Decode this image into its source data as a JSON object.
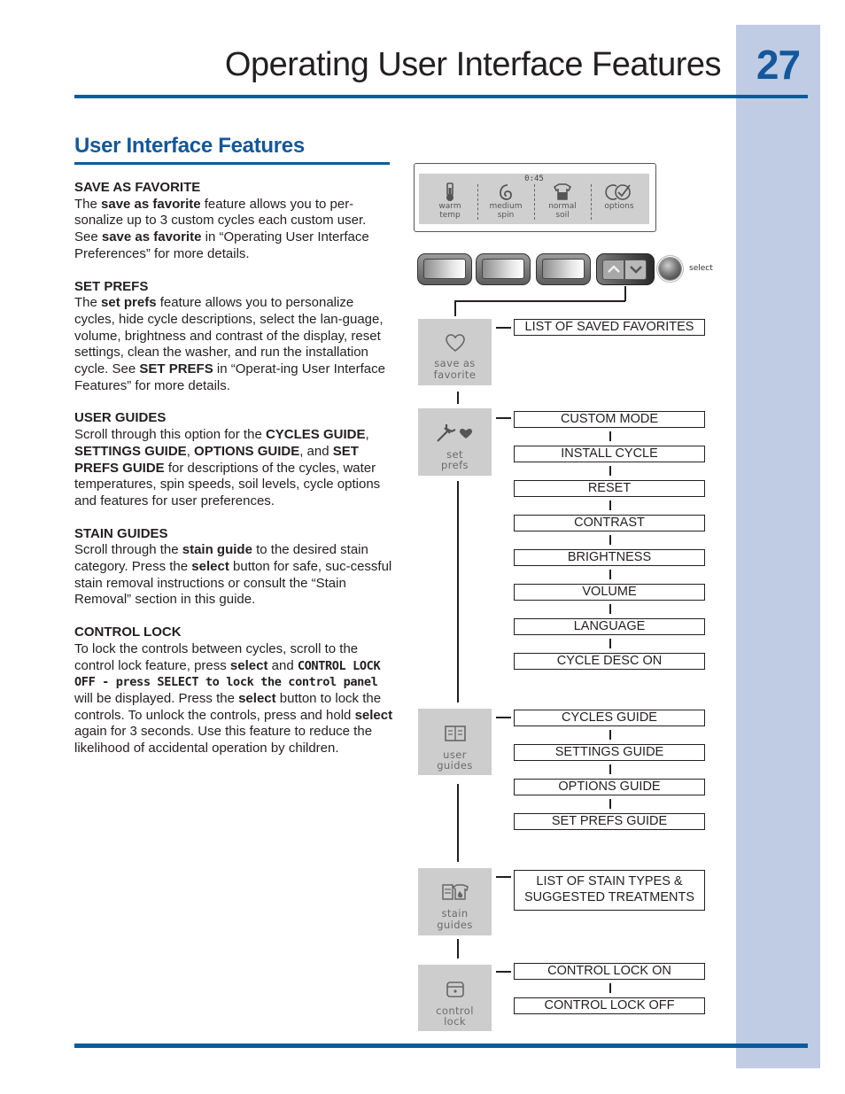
{
  "page": {
    "title": "Operating User Interface Features",
    "page_number": "27",
    "accent_color": "#075c9e",
    "sidebar_color": "#bfcce3"
  },
  "section": {
    "title": "User Interface Features"
  },
  "text_blocks": [
    {
      "heading": "SAVE AS FAVORITE",
      "segments": [
        {
          "t": "The "
        },
        {
          "t": "save as favorite",
          "b": true
        },
        {
          "t": " feature allows you to per-sonalize up to 3 custom cycles each custom user. See "
        },
        {
          "t": "save as favorite",
          "b": true
        },
        {
          "t": " in “Operating User Interface Preferences” for more details."
        }
      ]
    },
    {
      "heading": "SET PREFS",
      "segments": [
        {
          "t": "The "
        },
        {
          "t": "set prefs",
          "b": true
        },
        {
          "t": " feature allows you to personalize cycles, hide cycle descriptions, select the lan-guage, volume, brightness and contrast of the display, reset settings, clean the washer, and run the installation cycle. See "
        },
        {
          "t": "SET PREFS",
          "b": true
        },
        {
          "t": " in “Operat-ing User Interface Features” for more details."
        }
      ]
    },
    {
      "heading": "USER GUIDES",
      "segments": [
        {
          "t": "Scroll through this option for the "
        },
        {
          "t": "CYCLES GUIDE",
          "b": true
        },
        {
          "t": ", "
        },
        {
          "t": "SETTINGS GUIDE",
          "b": true
        },
        {
          "t": ", "
        },
        {
          "t": "OPTIONS GUIDE",
          "b": true
        },
        {
          "t": ", and "
        },
        {
          "t": "SET PREFS GUIDE",
          "b": true
        },
        {
          "t": " for descriptions of the cycles, water temperatures, spin speeds, soil levels, cycle options and features for user preferences."
        }
      ]
    },
    {
      "heading": "STAIN GUIDES",
      "segments": [
        {
          "t": "Scroll through the "
        },
        {
          "t": "stain guide",
          "b": true
        },
        {
          "t": " to the desired stain category. Press the "
        },
        {
          "t": "select",
          "b": true
        },
        {
          "t": " button for safe, suc-cessful stain removal instructions or consult the “Stain Removal” section in this guide."
        }
      ]
    },
    {
      "heading": "CONTROL LOCK",
      "segments": [
        {
          "t": "To lock the controls between cycles, scroll to the control lock feature, press "
        },
        {
          "t": "select",
          "b": true
        },
        {
          "t": " and "
        },
        {
          "t": "CONTROL LOCK OFF - press SELECT to lock the control panel",
          "lcd": true
        },
        {
          "t": " will be displayed. Press the "
        },
        {
          "t": "select",
          "b": true
        },
        {
          "t": " button to lock the controls. To unlock the controls, press and hold "
        },
        {
          "t": "select",
          "b": true
        },
        {
          "t": " again for 3 seconds. Use this feature to reduce the likelihood of accidental operation by children."
        }
      ]
    }
  ],
  "display": {
    "time": "0:45",
    "options": [
      {
        "icon": "thermometer-icon",
        "line1": "warm",
        "line2": "temp"
      },
      {
        "icon": "spiral-spin-icon",
        "line1": "medium",
        "line2": "spin"
      },
      {
        "icon": "shirt-soil-icon",
        "line1": "normal",
        "line2": "soil"
      },
      {
        "icon": "options-check-icon",
        "line1": "",
        "line2": "options"
      }
    ]
  },
  "controls": {
    "select_label": "select",
    "arrow_up_icon": "chevron-up-icon",
    "arrow_down_icon": "chevron-down-icon"
  },
  "menu": [
    {
      "icon": "heart-icon",
      "line1": "save as",
      "line2": "favorite",
      "items": [
        "LIST OF SAVED FAVORITES"
      ]
    },
    {
      "icon": "wrench-heart-icon",
      "line1": "set",
      "line2": "prefs",
      "items": [
        "CUSTOM MODE",
        "INSTALL CYCLE",
        "RESET",
        "CONTRAST",
        "BRIGHTNESS",
        "VOLUME",
        "LANGUAGE",
        "CYCLE DESC ON"
      ]
    },
    {
      "icon": "book-icon",
      "line1": "user",
      "line2": "guides",
      "items": [
        "CYCLES GUIDE",
        "SETTINGS GUIDE",
        "OPTIONS GUIDE",
        "SET PREFS GUIDE"
      ]
    },
    {
      "icon": "stain-shirt-icon",
      "line1": "stain",
      "line2": "guides",
      "items": [
        "LIST OF STAIN TYPES & SUGGESTED TREATMENTS"
      ]
    },
    {
      "icon": "lock-icon",
      "line1": "control",
      "line2": "lock",
      "items": [
        "CONTROL LOCK ON",
        "CONTROL LOCK OFF"
      ]
    }
  ]
}
